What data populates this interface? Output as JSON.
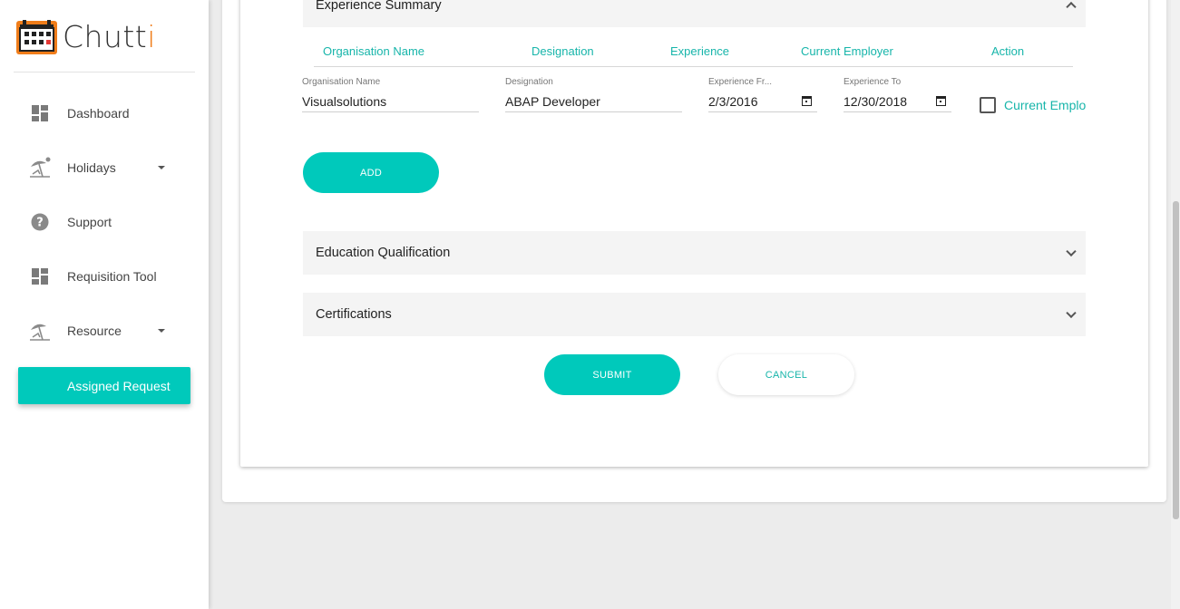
{
  "app": {
    "name_main": "Chutt",
    "name_accent": "i",
    "brand_color": "#00c9bb",
    "logo_color": "#f07d1a"
  },
  "sidebar": {
    "items": [
      {
        "label": "Dashboard",
        "icon": "dashboard-icon",
        "has_caret": false
      },
      {
        "label": "Holidays",
        "icon": "beach-icon",
        "has_caret": true
      },
      {
        "label": "Support",
        "icon": "help-icon",
        "has_caret": false
      },
      {
        "label": "Requisition Tool",
        "icon": "dashboard-icon",
        "has_caret": false
      },
      {
        "label": "Resource",
        "icon": "beach-icon",
        "has_caret": true
      }
    ],
    "active_item": "Assigned Request"
  },
  "experience": {
    "panel_title": "Experience Summary",
    "columns": [
      "Organisation Name",
      "Designation",
      "Experience",
      "Current Employer",
      "Action"
    ],
    "row": {
      "org_label": "Organisation Name",
      "org_value": "Visualsolutions",
      "designation_label": "Designation",
      "designation_value": "ABAP Developer",
      "from_label": "Experience Fr...",
      "from_value": "2/3/2016",
      "to_label": "Experience To",
      "to_value": "12/30/2018",
      "current_employer_label": "Current Employer",
      "current_employer_checked": false
    },
    "add_label": "ADD"
  },
  "education": {
    "panel_title": "Education Qualification"
  },
  "certifications": {
    "panel_title": "Certifications"
  },
  "actions": {
    "submit_label": "SUBMIT",
    "cancel_label": "CANCEL"
  }
}
